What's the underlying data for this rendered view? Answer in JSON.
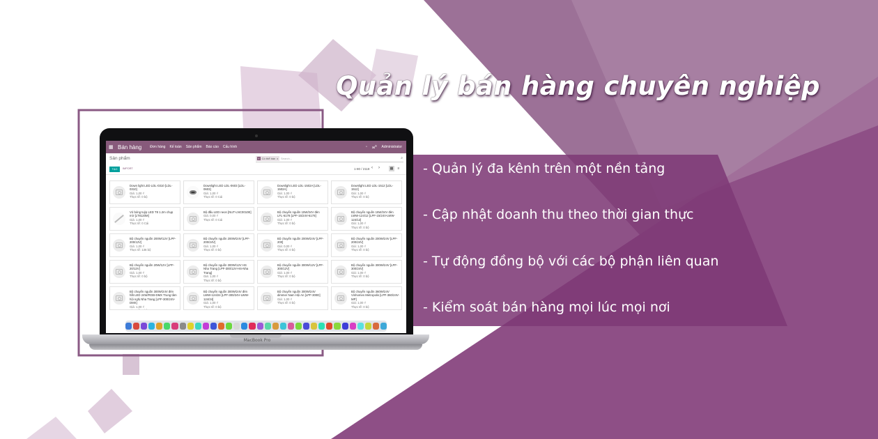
{
  "banner": {
    "headline": "Quản lý bán hàng chuyên nghiệp",
    "features": [
      "- Quản lý đa kênh trên một nền tảng",
      "- Cập nhật doanh thu theo thời gian thực",
      "- Tự động đồng bộ với các bộ phận liên quan",
      "- Kiểm soát bán hàng mọi lúc mọi nơi"
    ],
    "colors": {
      "primary_purple": "#8e5c88",
      "dark_purple": "#6e2f66",
      "light_purple": "#c8a7c3",
      "panel_purple": "#7a3a72"
    }
  },
  "laptop": {
    "brand": "MacBook Pro"
  },
  "app": {
    "title": "Bán hàng",
    "menu": [
      "Đơn hàng",
      "Kế toán",
      "Sản phẩm",
      "Báo cáo",
      "Cấu hình"
    ],
    "user": "Administrator",
    "chat_count": "9",
    "breadcrumb": "Sản phẩm",
    "search": {
      "facet_tag": "Y",
      "facet_label": "Có thể bán",
      "facet_close": "x",
      "placeholder": "Search..."
    },
    "create_label": "TẠO",
    "import_label": "IMPORT",
    "pager": "1-80 / 2118",
    "products": [
      {
        "name": "Down light LED LDL-0310 [LDL-0310]",
        "price": "Giá: 1,00 ₫",
        "stock": "Thực tế: 0 bộ",
        "image": "camera"
      },
      {
        "name": "Downlight LED LDL-0603 [LDL-0603]",
        "price": "Giá: 1,00 ₫",
        "stock": "Thực tế: 0 Cái",
        "image": "led"
      },
      {
        "name": "Downlight LED LDL-1502A [LDL-1502A]",
        "price": "Giá: 1,00 ₫",
        "stock": "Thực tế: 0 bộ",
        "image": "camera"
      },
      {
        "name": "Downlight LED LDL-1512 [LDL-1512]",
        "price": "Giá: 1,00 ₫",
        "stock": "Thực tế: 0 bộ",
        "image": "camera"
      },
      {
        "name": "Vỏ bóng tuýp LED T8 1.2m chụp mờ [LT8120M]",
        "price": "Giá: 1,00 ₫",
        "stock": "Thực tế: 0 Cái",
        "image": "tube"
      },
      {
        "name": "Bộ đấu LED neon [NUT-LNC0010E]",
        "price": "Giá: 0,00 ₫",
        "stock": "Thực tế: 0 Cái",
        "image": "camera"
      },
      {
        "name": "Bộ chuyển nguồn 15W/24V đèn LFL-6178 [LPF-15/24V-6178]",
        "price": "Giá: 1,00 ₫",
        "stock": "Thực tế: 0 bộ",
        "image": "camera"
      },
      {
        "name": "Bộ chuyển nguồn 15W/24V đèn LWW-124/12 [LPF-15/24V-LWW-124/12]",
        "price": "Giá: 1,00 ₫",
        "stock": "Thực tế: 0 bộ",
        "image": "camera"
      },
      {
        "name": "Bộ chuyển nguồn 200W/12V [LPF-200/12V]",
        "price": "Giá: 1,00 ₫",
        "stock": "Thực tế: 136 bộ",
        "image": "camera"
      },
      {
        "name": "Bộ chuyển nguồn 200W/24V [LPF-200/24V]",
        "price": "Giá: 1,00 ₫",
        "stock": "Thực tế: 0 bộ",
        "image": "camera"
      },
      {
        "name": "Bộ chuyển nguồn 200W/24V [LPF-200]",
        "price": "Giá: 0,00 ₫",
        "stock": "Thực tế: 0 bộ",
        "image": "camera"
      },
      {
        "name": "Bộ chuyển nguồn 200W/24V [LPF-200/24V]",
        "price": "Giá: 1,00 ₫",
        "stock": "Thực tế: 0 bộ",
        "image": "camera"
      },
      {
        "name": "Bộ chuyển nguồn 20W/12V [LPF-20/12V]",
        "price": "Giá: 1,00 ₫",
        "stock": "Thực tế: 0 bộ",
        "image": "camera"
      },
      {
        "name": "Bộ chuyển nguồn 300W/12V HS Nha Trang [LPF-300/12V-HS-Nha Trang]",
        "price": "Giá: 1,00 ₫",
        "stock": "Thực tế: 0 bộ",
        "image": "camera"
      },
      {
        "name": "Bộ chuyển nguồn 300W/12V [LPF-300/12V]",
        "price": "Giá: 1,00 ₫",
        "stock": "Thực tế: 0 bộ",
        "image": "camera"
      },
      {
        "name": "Bộ chuyển nguồn 300W/24V [LPF-300/24V]",
        "price": "Giá: 1,00 ₫",
        "stock": "Thực tế: 0 bộ",
        "image": "camera"
      },
      {
        "name": "Bộ chuyển nguồn 300W/24V đèn hắt LED 24W/RGB-DMX Trung tâm hội nghị Nha Trang [LPF-300/24V-DMX]",
        "price": "Giá: 1,00 ₫",
        "stock": "Thực tế: 0 bộ",
        "image": "camera"
      },
      {
        "name": "Bộ chuyển nguồn 300W/24V đèn LWW-124/24 [LPF-300/24V-LWW-124/24]",
        "price": "Giá: 1,00 ₫",
        "stock": "Thực tế: 0 bộ",
        "image": "camera"
      },
      {
        "name": "Bộ chuyển nguồn 300W/24V dimmer Nam Hội An [LPF-300D]",
        "price": "Giá: 1,00 ₫",
        "stock": "Thực tế: 0 bộ",
        "image": "camera"
      },
      {
        "name": "Bộ chuyển nguồn 360W/24V Vinhomes Metropolis [LPF-360/24V-MP]",
        "price": "Giá: 1,00 ₫",
        "stock": "Thực tế: 0 bộ",
        "image": "camera"
      }
    ],
    "dock_colors": [
      "#3d7bd8",
      "#d84a3d",
      "#7a4ad8",
      "#2bb3e0",
      "#e0a12b",
      "#4ad86a",
      "#d83d7b",
      "#8a8a8a",
      "#e0d22b",
      "#3dd8c4",
      "#c43dd8",
      "#3d55d8",
      "#e06b2b",
      "#6bd83d",
      "#d8d8d8",
      "#2b8ae0",
      "#e02b5a",
      "#9b5ad8",
      "#5ad8a8",
      "#d89b3d",
      "#3dc4d8",
      "#d85a9b",
      "#7bd83d",
      "#4a4ad8",
      "#d8c43d",
      "#2be0b3",
      "#e04a2b",
      "#8ad83d",
      "#3d3dd8",
      "#d83dc4",
      "#5ae0e0",
      "#c4d83d",
      "#d86b3d",
      "#3da8d8"
    ]
  }
}
